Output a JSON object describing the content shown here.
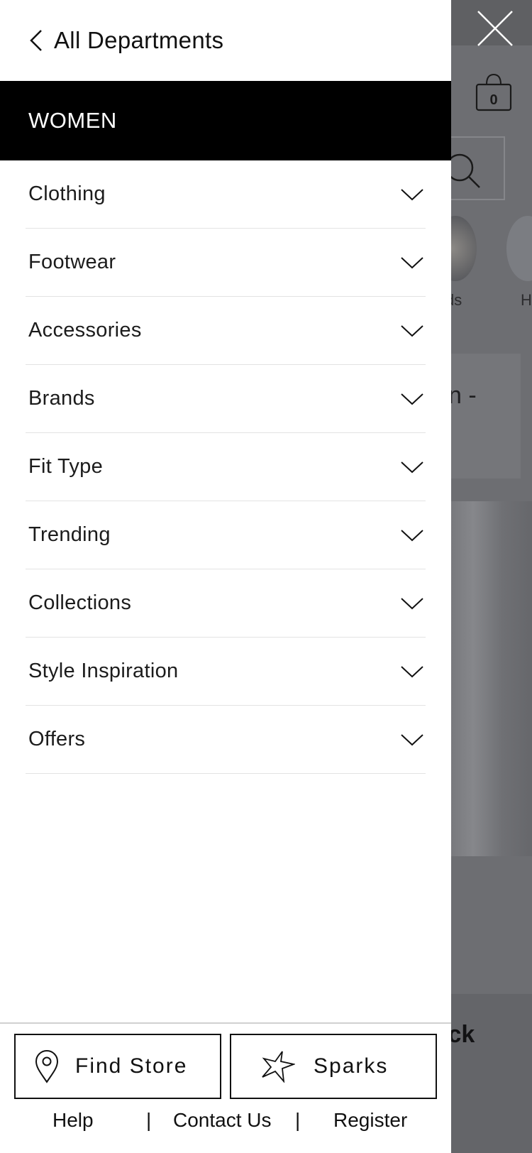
{
  "header": {
    "back_label": "All Departments"
  },
  "department": {
    "title": "WOMEN"
  },
  "menu": {
    "items": [
      {
        "label": "Clothing"
      },
      {
        "label": "Footwear"
      },
      {
        "label": "Accessories"
      },
      {
        "label": "Brands"
      },
      {
        "label": "Fit Type"
      },
      {
        "label": "Trending"
      },
      {
        "label": "Collections"
      },
      {
        "label": "Style Inspiration"
      },
      {
        "label": "Offers"
      }
    ]
  },
  "footer": {
    "find_store_label": "Find Store",
    "sparks_label": "Sparks",
    "links": {
      "help": "Help",
      "contact": "Contact Us",
      "register": "Register",
      "separator": "|"
    }
  },
  "background": {
    "bag_count": "0",
    "circle_label_1": "ds",
    "circle_label_2": "H",
    "banner_text": "n -",
    "strip_text": "ick"
  },
  "colors": {
    "overlay": "#6d6e72",
    "dept_bar": "#000000",
    "drawer": "#ffffff"
  }
}
